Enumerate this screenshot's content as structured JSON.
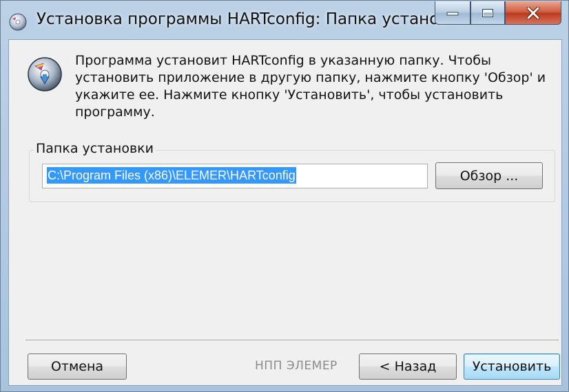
{
  "window": {
    "title": "Установка программы HARTconfig: Папка установки"
  },
  "dialog": {
    "description": "Программа установит HARTconfig в указанную папку. Чтобы установить приложение в другую папку, нажмите кнопку 'Обзор' и укажите ее. Нажмите кнопку 'Установить', чтобы установить программу.",
    "folder_group_label": "Папка установки",
    "path_value": "C:\\Program Files (x86)\\ELEMER\\HARTconfig",
    "browse_label": "Обзор ..."
  },
  "footer": {
    "cancel_label": "Отмена",
    "brand_label": "НПП ЭЛЕМЕР",
    "back_label": "< Назад",
    "install_label": "Установить"
  },
  "icons": {
    "app": "installer-disc-icon",
    "header": "installer-disc-download-icon",
    "minimize": "minimize-icon",
    "maximize": "maximize-icon",
    "close": "close-icon"
  },
  "colors": {
    "selection": "#3399ff",
    "close_button": "#c8452a",
    "default_button_border": "#3c7fb1"
  }
}
